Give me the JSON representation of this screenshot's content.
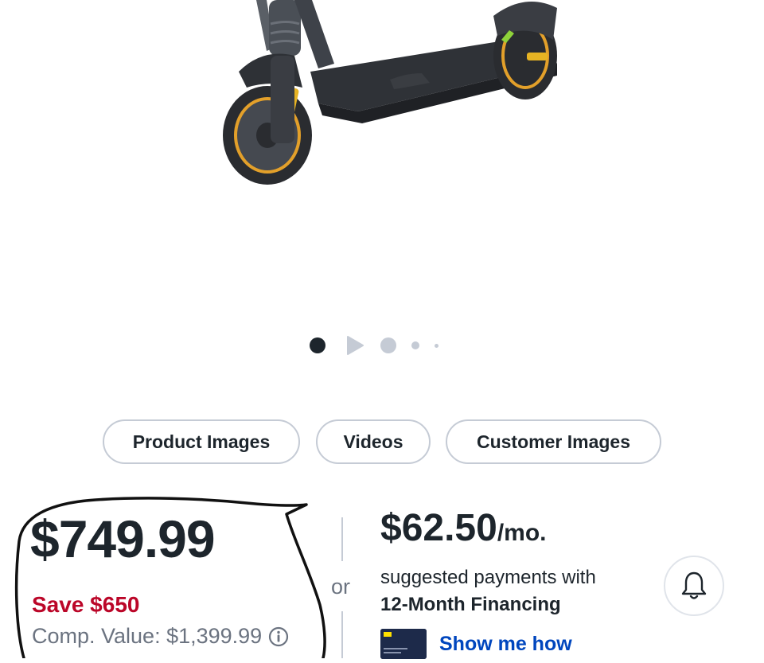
{
  "media_tabs": [
    "Product Images",
    "Videos",
    "Customer Images"
  ],
  "price": {
    "current": "$749.99",
    "save": "Save $650",
    "comp_value": "Comp. Value: $1,399.99"
  },
  "financing": {
    "monthly_amount": "$62.50",
    "monthly_suffix": "/mo.",
    "or_label": "or",
    "description": "suggested payments with",
    "plan": "12-Month Financing",
    "link": "Show me how"
  },
  "icons": {
    "info": "info-icon",
    "bell": "bell-icon",
    "video": "play-icon"
  },
  "colors": {
    "save_red": "#bb0628",
    "link_blue": "#0046be",
    "text": "#1d252c",
    "muted": "#6b7380"
  }
}
